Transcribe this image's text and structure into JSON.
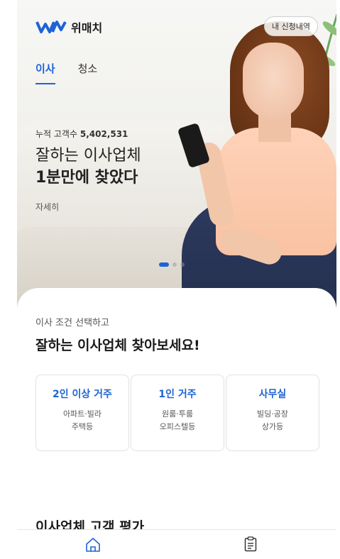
{
  "header": {
    "brand": "위매치",
    "history_button": "내 신청내역"
  },
  "tabs": [
    {
      "label": "이사",
      "active": true
    },
    {
      "label": "청소",
      "active": false
    }
  ],
  "hero": {
    "count_label": "누적 고객수",
    "count_value": "5,402,531",
    "headline_line1": "잘하는 이사업체",
    "headline_line2": "1분만에 찾았다",
    "detail_link": "자세히",
    "slides_total": 3,
    "slide_active": 1
  },
  "main": {
    "subtitle": "이사 조건 선택하고",
    "title": "잘하는 이사업체 찾아보세요!",
    "options": [
      {
        "title": "2인 이상 거주",
        "desc1": "아파트·빌라",
        "desc2": "주택등"
      },
      {
        "title": "1인 거주",
        "desc1": "원룸·투룸",
        "desc2": "오피스텔등"
      },
      {
        "title": "사무실",
        "desc1": "빌딩·공장",
        "desc2": "상가등"
      }
    ],
    "reviews_title": "이사업체 고객 평가"
  },
  "bottom_nav": {
    "items": [
      {
        "icon": "home-icon"
      },
      {
        "icon": "clipboard-list-icon"
      }
    ]
  },
  "colors": {
    "accent": "#1e63d6",
    "text": "#222222",
    "muted": "#555555"
  }
}
